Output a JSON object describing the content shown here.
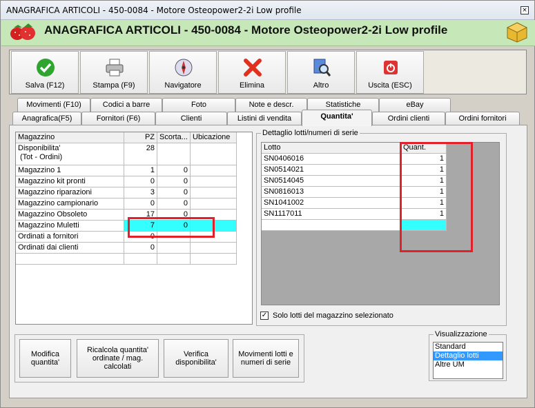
{
  "window": {
    "title": "ANAGRAFICA ARTICOLI - 450-0084 - Motore Osteopower2-2i Low profile",
    "close": "×"
  },
  "header": {
    "title": "ANAGRAFICA ARTICOLI - 450-0084 - Motore Osteopower2-2i Low profile"
  },
  "toolbar": {
    "salva": "Salva (F12)",
    "stampa": "Stampa (F9)",
    "navigatore": "Navigatore",
    "elimina": "Elimina",
    "altro": "Altro",
    "uscita": "Uscita (ESC)"
  },
  "tabs_row1": [
    "Movimenti (F10)",
    "Codici a barre",
    "Foto",
    "Note e descr.",
    "Statistiche",
    "eBay"
  ],
  "tabs_row2": [
    "Anagrafica(F5)",
    "Fornitori (F6)",
    "Clienti",
    "Listini di vendita",
    "Quantita'",
    "Ordini clienti",
    "Ordini fornitori"
  ],
  "stock_table": {
    "headers": [
      "Magazzino",
      "PZ",
      "Scorta...",
      "Ubicazione"
    ],
    "rows": [
      {
        "name": "Disponibilita'",
        "name2": "(Tot - Ordini)",
        "pz": "28",
        "scorta": "",
        "ubic": ""
      },
      {
        "name": "Magazzino 1",
        "pz": "1",
        "scorta": "0",
        "ubic": ""
      },
      {
        "name": "Magazzino kit pronti",
        "pz": "0",
        "scorta": "0",
        "ubic": ""
      },
      {
        "name": "Magazzino riparazioni",
        "pz": "3",
        "scorta": "0",
        "ubic": ""
      },
      {
        "name": "Magazzino campionario",
        "pz": "0",
        "scorta": "0",
        "ubic": ""
      },
      {
        "name": "Magazzino Obsoleto",
        "pz": "17",
        "scorta": "0",
        "ubic": ""
      },
      {
        "name": "Magazzino Muletti",
        "pz": "7",
        "scorta": "0",
        "ubic": ""
      },
      {
        "name": "Ordinati a fornitori",
        "pz": "0",
        "scorta": "",
        "ubic": ""
      },
      {
        "name": "Ordinati dai clienti",
        "pz": "0",
        "scorta": "",
        "ubic": ""
      }
    ]
  },
  "lots": {
    "group_label": "Dettaglio lotti/numeri di serie",
    "headers": [
      "Lotto",
      "Quant."
    ],
    "rows": [
      {
        "lotto": "SN0406016",
        "qty": "1"
      },
      {
        "lotto": "SN0514021",
        "qty": "1"
      },
      {
        "lotto": "SN0514045",
        "qty": "1"
      },
      {
        "lotto": "SN0816013",
        "qty": "1"
      },
      {
        "lotto": "SN1041002",
        "qty": "1"
      },
      {
        "lotto": "SN1117011",
        "qty": "1"
      }
    ],
    "checkbox_label": "Solo lotti del magazzino selezionato",
    "checkbox_mark": "✓"
  },
  "actions": {
    "modifica": "Modifica\nquantita'",
    "ricalcola": "Ricalcola quantita'\nordinate / mag.\ncalcolati",
    "verifica": "Verifica\ndisponibilita'",
    "movimenti": "Movimenti lotti e\nnumeri di serie"
  },
  "visualizzazione": {
    "label": "Visualizzazione",
    "options": [
      "Standard",
      "Dettaglio lotti",
      "Altre UM"
    ],
    "selected": "Dettaglio lotti"
  },
  "colors": {
    "header_bg": "#c6e8b8",
    "selected_row": "#33ffff",
    "highlight_box": "#e0202a",
    "grid_bg": "#a8a8a8"
  }
}
